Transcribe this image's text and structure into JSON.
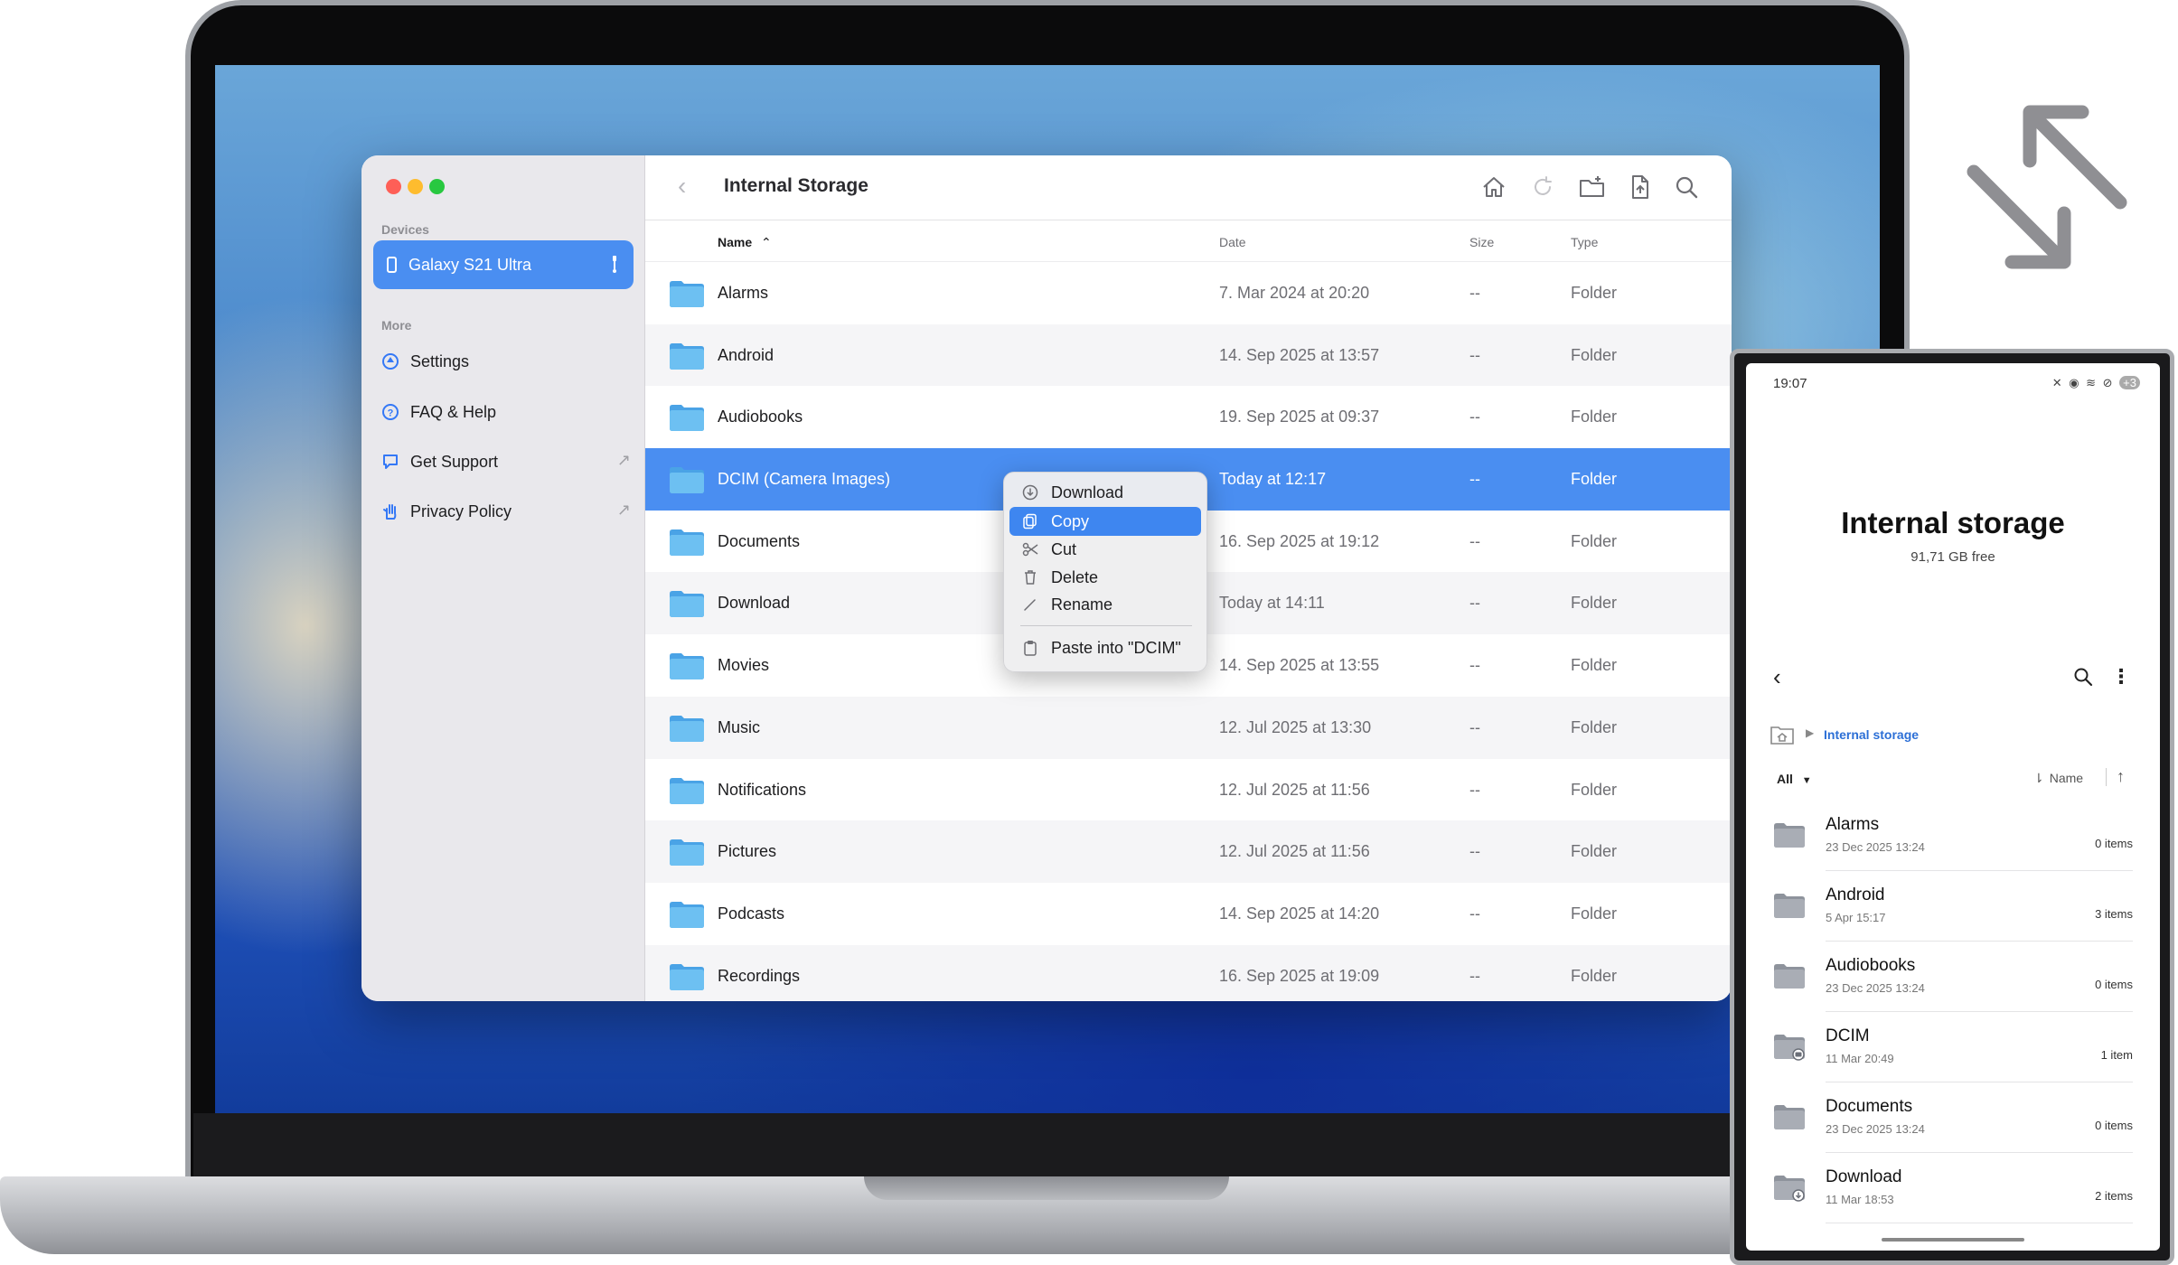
{
  "window": {
    "title": "Internal Storage"
  },
  "sidebar": {
    "devices_heading": "Devices",
    "device": {
      "label": "Galaxy S21 Ultra",
      "icon": "phone-icon",
      "connection_icon": "usb-icon"
    },
    "more_heading": "More",
    "items": [
      {
        "label": "Settings",
        "icon": "gear-icon"
      },
      {
        "label": "FAQ & Help",
        "icon": "question-icon"
      },
      {
        "label": "Get Support",
        "icon": "chat-bubble-icon",
        "external": true
      },
      {
        "label": "Privacy Policy",
        "icon": "hand-icon",
        "external": true
      }
    ]
  },
  "columns": {
    "name": "Name",
    "date": "Date",
    "size": "Size",
    "type": "Type"
  },
  "files": [
    {
      "name": "Alarms",
      "date": "7. Mar 2024 at 20:20",
      "size": "--",
      "type": "Folder"
    },
    {
      "name": "Android",
      "date": "14. Sep 2025 at 13:57",
      "size": "--",
      "type": "Folder"
    },
    {
      "name": "Audiobooks",
      "date": "19. Sep 2025 at 09:37",
      "size": "--",
      "type": "Folder"
    },
    {
      "name": "DCIM (Camera Images)",
      "date": "Today at 12:17",
      "size": "--",
      "type": "Folder",
      "selected": true
    },
    {
      "name": "Documents",
      "date": "16. Sep 2025 at 19:12",
      "size": "--",
      "type": "Folder"
    },
    {
      "name": "Download",
      "date": "Today at 14:11",
      "size": "--",
      "type": "Folder"
    },
    {
      "name": "Movies",
      "date": "14. Sep 2025 at 13:55",
      "size": "--",
      "type": "Folder"
    },
    {
      "name": "Music",
      "date": "12. Jul 2025 at 13:30",
      "size": "--",
      "type": "Folder"
    },
    {
      "name": "Notifications",
      "date": "12. Jul 2025 at 11:56",
      "size": "--",
      "type": "Folder"
    },
    {
      "name": "Pictures",
      "date": "12. Jul 2025 at 11:56",
      "size": "--",
      "type": "Folder"
    },
    {
      "name": "Podcasts",
      "date": "14. Sep 2025 at 14:20",
      "size": "--",
      "type": "Folder"
    },
    {
      "name": "Recordings",
      "date": "16. Sep 2025 at 19:09",
      "size": "--",
      "type": "Folder"
    }
  ],
  "context_menu": {
    "items": [
      {
        "label": "Download",
        "icon": "download-icon"
      },
      {
        "label": "Copy",
        "icon": "copy-icon",
        "highlighted": true
      },
      {
        "label": "Cut",
        "icon": "scissors-icon"
      },
      {
        "label": "Delete",
        "icon": "trash-icon"
      },
      {
        "label": "Rename",
        "icon": "pencil-icon"
      },
      {
        "label": "Paste into \"DCIM\"",
        "icon": "paste-icon"
      }
    ]
  },
  "colors": {
    "accent": "#4a8ef1",
    "folder": "#5fb0ec"
  },
  "phone": {
    "status_time": "19:07",
    "status_badge": "+3",
    "title": "Internal storage",
    "free_space": "91,71 GB free",
    "breadcrumb": "Internal storage",
    "filter": "All",
    "sort_by": "Name",
    "items": [
      {
        "name": "Alarms",
        "date": "23 Dec 2025 13:24",
        "count": "0 items"
      },
      {
        "name": "Android",
        "date": "5 Apr 15:17",
        "count": "3 items"
      },
      {
        "name": "Audiobooks",
        "date": "23 Dec 2025 13:24",
        "count": "0 items"
      },
      {
        "name": "DCIM",
        "date": "11 Mar 20:49",
        "count": "1 item",
        "badge": "camera"
      },
      {
        "name": "Documents",
        "date": "23 Dec 2025 13:24",
        "count": "0 items"
      },
      {
        "name": "Download",
        "date": "11 Mar 18:53",
        "count": "2 items",
        "badge": "download"
      }
    ]
  }
}
